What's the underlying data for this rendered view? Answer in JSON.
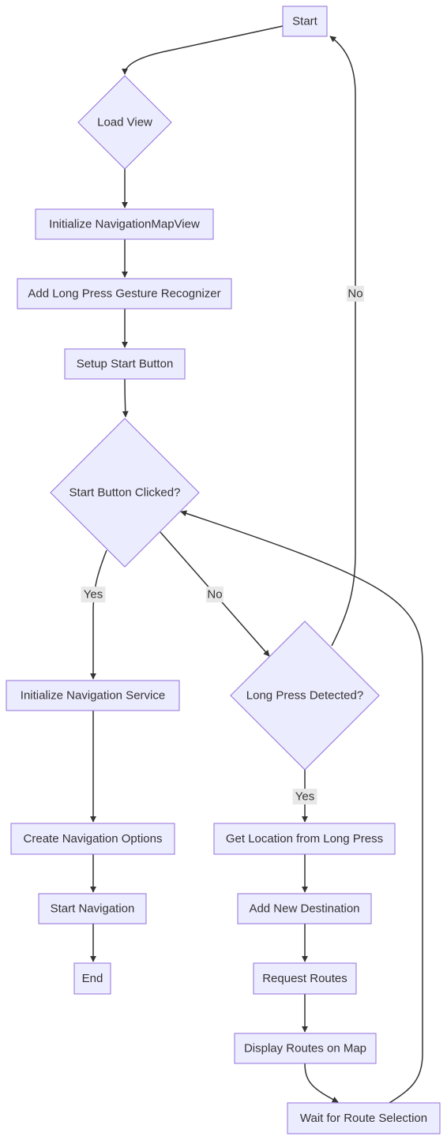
{
  "colors": {
    "node_fill": "#ECECFF",
    "node_stroke": "#9370DB",
    "edge": "#333333",
    "edge_label_bg": "#e8e8e8"
  },
  "nodes": [
    {
      "id": "start",
      "label": "Start",
      "shape": "rect"
    },
    {
      "id": "load",
      "label": "Load View",
      "shape": "diamond"
    },
    {
      "id": "initmap",
      "label": "Initialize NavigationMapView",
      "shape": "rect"
    },
    {
      "id": "addlp",
      "label": "Add Long Press Gesture Recognizer",
      "shape": "rect"
    },
    {
      "id": "setup",
      "label": "Setup Start Button",
      "shape": "rect"
    },
    {
      "id": "clicked",
      "label": "Start Button Clicked?",
      "shape": "diamond"
    },
    {
      "id": "initnav",
      "label": "Initialize Navigation Service",
      "shape": "rect"
    },
    {
      "id": "lpdet",
      "label": "Long Press Detected?",
      "shape": "diamond"
    },
    {
      "id": "opts",
      "label": "Create Navigation Options",
      "shape": "rect"
    },
    {
      "id": "startnav",
      "label": "Start Navigation",
      "shape": "rect"
    },
    {
      "id": "end",
      "label": "End",
      "shape": "rect"
    },
    {
      "id": "getloc",
      "label": "Get Location from Long Press",
      "shape": "rect"
    },
    {
      "id": "adddest",
      "label": "Add New Destination",
      "shape": "rect"
    },
    {
      "id": "req",
      "label": "Request Routes",
      "shape": "rect"
    },
    {
      "id": "disp",
      "label": "Display Routes on Map",
      "shape": "rect"
    },
    {
      "id": "wait",
      "label": "Wait for Route Selection",
      "shape": "rect"
    }
  ],
  "edges": [
    {
      "from": "start",
      "to": "load",
      "label": ""
    },
    {
      "from": "load",
      "to": "initmap",
      "label": ""
    },
    {
      "from": "initmap",
      "to": "addlp",
      "label": ""
    },
    {
      "from": "addlp",
      "to": "setup",
      "label": ""
    },
    {
      "from": "setup",
      "to": "clicked",
      "label": ""
    },
    {
      "from": "clicked",
      "to": "initnav",
      "label": "Yes"
    },
    {
      "from": "clicked",
      "to": "lpdet",
      "label": "No"
    },
    {
      "from": "lpdet",
      "to": "start",
      "label": "No"
    },
    {
      "from": "lpdet",
      "to": "getloc",
      "label": "Yes"
    },
    {
      "from": "initnav",
      "to": "opts",
      "label": ""
    },
    {
      "from": "opts",
      "to": "startnav",
      "label": ""
    },
    {
      "from": "startnav",
      "to": "end",
      "label": ""
    },
    {
      "from": "getloc",
      "to": "adddest",
      "label": ""
    },
    {
      "from": "adddest",
      "to": "req",
      "label": ""
    },
    {
      "from": "req",
      "to": "disp",
      "label": ""
    },
    {
      "from": "disp",
      "to": "wait",
      "label": ""
    },
    {
      "from": "wait",
      "to": "clicked",
      "label": ""
    }
  ]
}
